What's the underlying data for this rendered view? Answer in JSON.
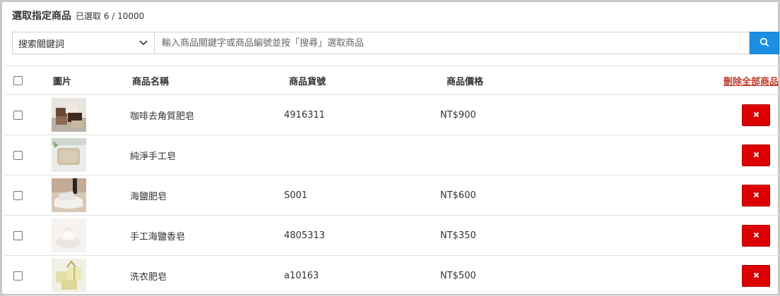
{
  "header": {
    "title": "選取指定商品",
    "selected_count": "已選取 6 / 10000"
  },
  "search": {
    "select_value": "搜索關鍵詞",
    "placeholder": "輸入商品關鍵字或商品編號並按「搜尋」選取商品",
    "button_icon": "search-icon"
  },
  "table": {
    "headers": {
      "image": "圖片",
      "name": "商品名稱",
      "sku": "商品貨號",
      "price": "商品價格",
      "delete_all": "刪除全部商品"
    },
    "rows": [
      {
        "name": "咖啡去角質肥皂",
        "sku": "4916311",
        "price": "NT$900"
      },
      {
        "name": "純淨手工皂",
        "sku": "",
        "price": ""
      },
      {
        "name": "海鹽肥皂",
        "sku": "S001",
        "price": "NT$600"
      },
      {
        "name": "手工海鹽香皂",
        "sku": "4805313",
        "price": "NT$350"
      },
      {
        "name": "洗衣肥皂",
        "sku": "a10163",
        "price": "NT$500"
      }
    ],
    "delete_button_icon": "close-icon"
  },
  "colors": {
    "accent": "#1a8fe3",
    "danger": "#dd0000",
    "link_danger": "#c0392b"
  }
}
